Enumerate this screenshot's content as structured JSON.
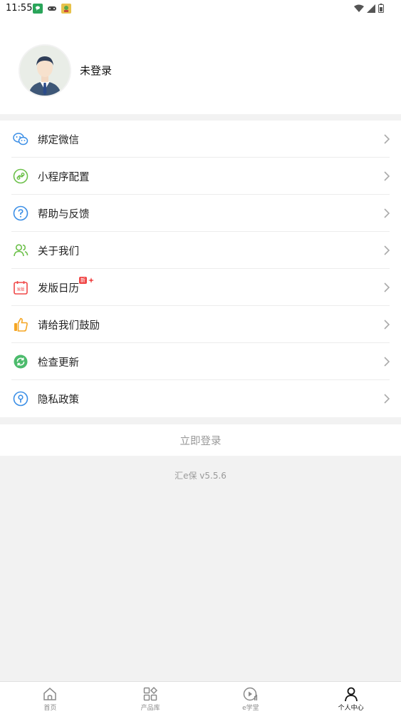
{
  "status_bar": {
    "time": "11:55",
    "app_icons": [
      "wechat-icon",
      "gamepad-icon",
      "game-app-icon"
    ]
  },
  "profile": {
    "login_state": "未登录"
  },
  "menu": {
    "items": [
      {
        "label": "绑定微信",
        "icon": "wechat-icon"
      },
      {
        "label": "小程序配置",
        "icon": "mini-program-icon"
      },
      {
        "label": "帮助与反馈",
        "icon": "help-icon"
      },
      {
        "label": "关于我们",
        "icon": "users-icon"
      },
      {
        "label": "发版日历",
        "icon": "calendar-icon",
        "badge": "新",
        "icon_text": "发版"
      },
      {
        "label": "请给我们鼓励",
        "icon": "thumbs-up-icon"
      },
      {
        "label": "检查更新",
        "icon": "refresh-icon"
      },
      {
        "label": "隐私政策",
        "icon": "privacy-icon"
      }
    ]
  },
  "login_button": "立即登录",
  "version": "汇e保  v5.5.6",
  "tabbar": {
    "tabs": [
      {
        "label": "首页",
        "icon": "home-icon"
      },
      {
        "label": "产品库",
        "icon": "grid-icon"
      },
      {
        "label": "e学堂",
        "icon": "play-icon"
      },
      {
        "label": "个人中心",
        "icon": "person-icon",
        "active": true
      }
    ]
  },
  "colors": {
    "accent_green": "#6cc04a",
    "accent_blue": "#3a8ee6",
    "badge_red": "#f04848",
    "muted_text": "#999999"
  }
}
